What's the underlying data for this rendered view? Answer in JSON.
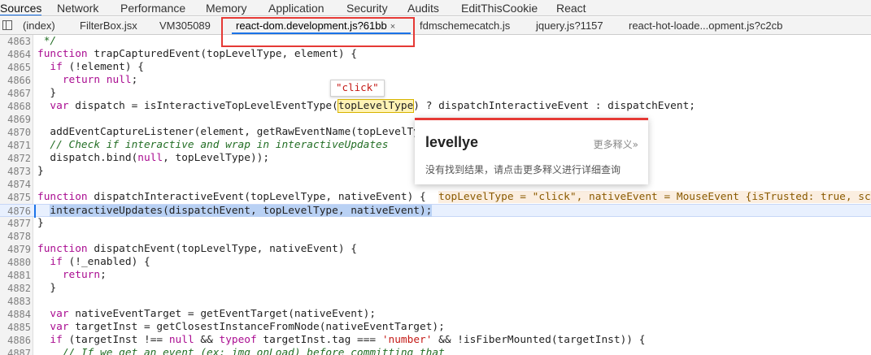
{
  "panel_tabs": [
    "Sources",
    "Network",
    "Performance",
    "Memory",
    "Application",
    "Security",
    "Audits",
    "EditThisCookie",
    "React"
  ],
  "file_tabs": [
    "(index)",
    "FilterBox.jsx",
    "VM305089",
    "react-dom.development.js?61bb",
    "fdmschemecatch.js",
    "jquery.js?1157",
    "react-hot-loade...opment.js?c2cb"
  ],
  "active_file_close": "×",
  "lines": [
    {
      "num": "4863",
      "text": " */"
    },
    {
      "num": "4864",
      "text": "function trapCapturedEvent(topLevelType, element) {"
    },
    {
      "num": "4865",
      "text": "  if (!element) {"
    },
    {
      "num": "4866",
      "text": "    return null;"
    },
    {
      "num": "4867",
      "text": "  }"
    },
    {
      "num": "4868",
      "text": "  var dispatch = isInteractiveTopLevelEventType(topLevelType) ? dispatchInteractiveEvent : dispatchEvent;"
    },
    {
      "num": "4869",
      "text": ""
    },
    {
      "num": "4870",
      "text": "  addEventCaptureListener(element, getRawEventName(topLevelTy"
    },
    {
      "num": "4871",
      "text": "  // Check if interactive and wrap in interactiveUpdates"
    },
    {
      "num": "4872",
      "text": "  dispatch.bind(null, topLevelType));"
    },
    {
      "num": "4873",
      "text": "}"
    },
    {
      "num": "4874",
      "text": ""
    },
    {
      "num": "4875",
      "text": "function dispatchInteractiveEvent(topLevelType, nativeEvent) {"
    },
    {
      "num": "4876",
      "text": "  interactiveUpdates(dispatchEvent, topLevelType, nativeEvent);"
    },
    {
      "num": "4877",
      "text": "}"
    },
    {
      "num": "4878",
      "text": ""
    },
    {
      "num": "4879",
      "text": "function dispatchEvent(topLevelType, nativeEvent) {"
    },
    {
      "num": "4880",
      "text": "  if (!_enabled) {"
    },
    {
      "num": "4881",
      "text": "    return;"
    },
    {
      "num": "4882",
      "text": "  }"
    },
    {
      "num": "4883",
      "text": ""
    },
    {
      "num": "4884",
      "text": "  var nativeEventTarget = getEventTarget(nativeEvent);"
    },
    {
      "num": "4885",
      "text": "  var targetInst = getClosestInstanceFromNode(nativeEventTarget);"
    },
    {
      "num": "4886",
      "text": "  if (targetInst !== null && typeof targetInst.tag === 'number' && !isFiberMounted(targetInst)) {"
    },
    {
      "num": "4887",
      "text": "    // If we get an event (ex: img onLoad) before committing that"
    }
  ],
  "inline_value": "topLevelType = \"click\", nativeEvent = MouseEvent {isTrusted: true, scr",
  "hover_value": "\"click\"",
  "dict": {
    "word": "levellye",
    "more": "更多释义»",
    "message": "没有找到结果，请点击更多释义进行详细查询"
  },
  "colors": {
    "accent": "#1a73e8",
    "red": "#e53935",
    "keyword": "#aa0d91",
    "comment": "#236e25",
    "string": "#c41a16"
  }
}
